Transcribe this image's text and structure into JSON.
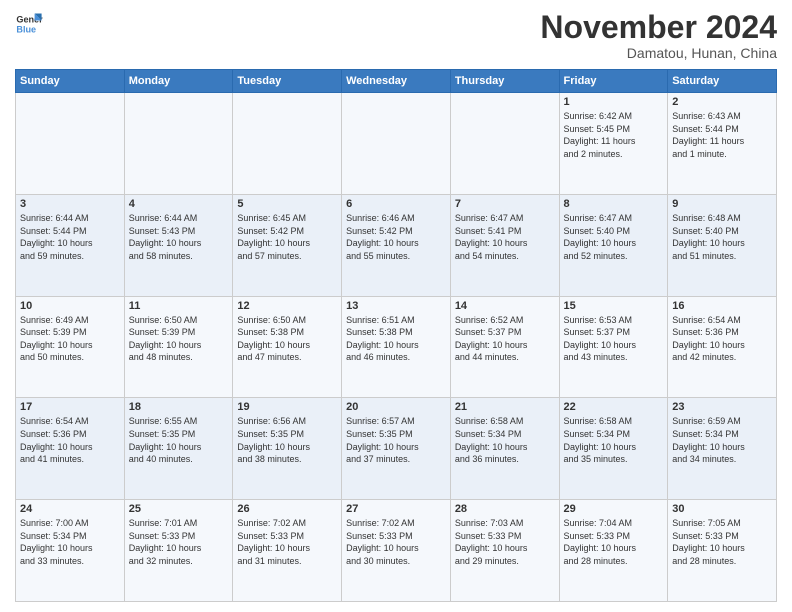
{
  "header": {
    "logo_line1": "General",
    "logo_line2": "Blue",
    "month": "November 2024",
    "location": "Damatou, Hunan, China"
  },
  "weekdays": [
    "Sunday",
    "Monday",
    "Tuesday",
    "Wednesday",
    "Thursday",
    "Friday",
    "Saturday"
  ],
  "weeks": [
    [
      {
        "day": "",
        "info": ""
      },
      {
        "day": "",
        "info": ""
      },
      {
        "day": "",
        "info": ""
      },
      {
        "day": "",
        "info": ""
      },
      {
        "day": "",
        "info": ""
      },
      {
        "day": "1",
        "info": "Sunrise: 6:42 AM\nSunset: 5:45 PM\nDaylight: 11 hours\nand 2 minutes."
      },
      {
        "day": "2",
        "info": "Sunrise: 6:43 AM\nSunset: 5:44 PM\nDaylight: 11 hours\nand 1 minute."
      }
    ],
    [
      {
        "day": "3",
        "info": "Sunrise: 6:44 AM\nSunset: 5:44 PM\nDaylight: 10 hours\nand 59 minutes."
      },
      {
        "day": "4",
        "info": "Sunrise: 6:44 AM\nSunset: 5:43 PM\nDaylight: 10 hours\nand 58 minutes."
      },
      {
        "day": "5",
        "info": "Sunrise: 6:45 AM\nSunset: 5:42 PM\nDaylight: 10 hours\nand 57 minutes."
      },
      {
        "day": "6",
        "info": "Sunrise: 6:46 AM\nSunset: 5:42 PM\nDaylight: 10 hours\nand 55 minutes."
      },
      {
        "day": "7",
        "info": "Sunrise: 6:47 AM\nSunset: 5:41 PM\nDaylight: 10 hours\nand 54 minutes."
      },
      {
        "day": "8",
        "info": "Sunrise: 6:47 AM\nSunset: 5:40 PM\nDaylight: 10 hours\nand 52 minutes."
      },
      {
        "day": "9",
        "info": "Sunrise: 6:48 AM\nSunset: 5:40 PM\nDaylight: 10 hours\nand 51 minutes."
      }
    ],
    [
      {
        "day": "10",
        "info": "Sunrise: 6:49 AM\nSunset: 5:39 PM\nDaylight: 10 hours\nand 50 minutes."
      },
      {
        "day": "11",
        "info": "Sunrise: 6:50 AM\nSunset: 5:39 PM\nDaylight: 10 hours\nand 48 minutes."
      },
      {
        "day": "12",
        "info": "Sunrise: 6:50 AM\nSunset: 5:38 PM\nDaylight: 10 hours\nand 47 minutes."
      },
      {
        "day": "13",
        "info": "Sunrise: 6:51 AM\nSunset: 5:38 PM\nDaylight: 10 hours\nand 46 minutes."
      },
      {
        "day": "14",
        "info": "Sunrise: 6:52 AM\nSunset: 5:37 PM\nDaylight: 10 hours\nand 44 minutes."
      },
      {
        "day": "15",
        "info": "Sunrise: 6:53 AM\nSunset: 5:37 PM\nDaylight: 10 hours\nand 43 minutes."
      },
      {
        "day": "16",
        "info": "Sunrise: 6:54 AM\nSunset: 5:36 PM\nDaylight: 10 hours\nand 42 minutes."
      }
    ],
    [
      {
        "day": "17",
        "info": "Sunrise: 6:54 AM\nSunset: 5:36 PM\nDaylight: 10 hours\nand 41 minutes."
      },
      {
        "day": "18",
        "info": "Sunrise: 6:55 AM\nSunset: 5:35 PM\nDaylight: 10 hours\nand 40 minutes."
      },
      {
        "day": "19",
        "info": "Sunrise: 6:56 AM\nSunset: 5:35 PM\nDaylight: 10 hours\nand 38 minutes."
      },
      {
        "day": "20",
        "info": "Sunrise: 6:57 AM\nSunset: 5:35 PM\nDaylight: 10 hours\nand 37 minutes."
      },
      {
        "day": "21",
        "info": "Sunrise: 6:58 AM\nSunset: 5:34 PM\nDaylight: 10 hours\nand 36 minutes."
      },
      {
        "day": "22",
        "info": "Sunrise: 6:58 AM\nSunset: 5:34 PM\nDaylight: 10 hours\nand 35 minutes."
      },
      {
        "day": "23",
        "info": "Sunrise: 6:59 AM\nSunset: 5:34 PM\nDaylight: 10 hours\nand 34 minutes."
      }
    ],
    [
      {
        "day": "24",
        "info": "Sunrise: 7:00 AM\nSunset: 5:34 PM\nDaylight: 10 hours\nand 33 minutes."
      },
      {
        "day": "25",
        "info": "Sunrise: 7:01 AM\nSunset: 5:33 PM\nDaylight: 10 hours\nand 32 minutes."
      },
      {
        "day": "26",
        "info": "Sunrise: 7:02 AM\nSunset: 5:33 PM\nDaylight: 10 hours\nand 31 minutes."
      },
      {
        "day": "27",
        "info": "Sunrise: 7:02 AM\nSunset: 5:33 PM\nDaylight: 10 hours\nand 30 minutes."
      },
      {
        "day": "28",
        "info": "Sunrise: 7:03 AM\nSunset: 5:33 PM\nDaylight: 10 hours\nand 29 minutes."
      },
      {
        "day": "29",
        "info": "Sunrise: 7:04 AM\nSunset: 5:33 PM\nDaylight: 10 hours\nand 28 minutes."
      },
      {
        "day": "30",
        "info": "Sunrise: 7:05 AM\nSunset: 5:33 PM\nDaylight: 10 hours\nand 28 minutes."
      }
    ]
  ]
}
